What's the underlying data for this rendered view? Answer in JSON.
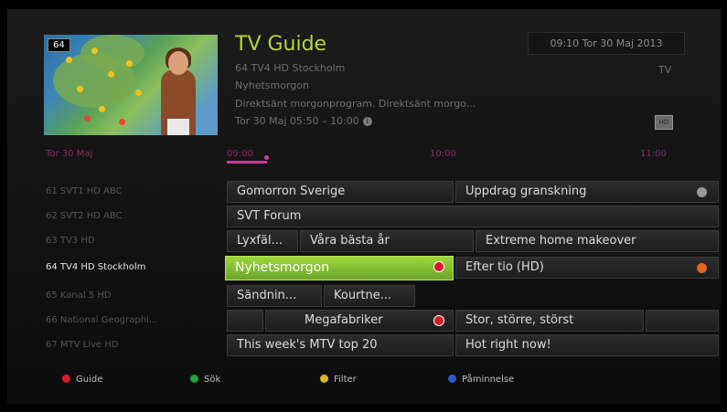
{
  "header": {
    "title": "TV Guide",
    "clock": "09:10  Tor 30 Maj 2013",
    "tv_tag": "TV",
    "preview_channel": "64",
    "program_channel": "64 TV4 HD Stockholm",
    "program_title": "Nyhetsmorgon",
    "program_desc": "Direktsänt morgonprogram. Direktsänt morgo...",
    "program_time": "Tor 30 Maj 05:50 – 10:00",
    "info_icon": "i",
    "hd_icon": "HD"
  },
  "timeline": {
    "date": "Tor 30 Maj",
    "times": [
      "09:00",
      "10:00",
      "11:00"
    ],
    "progress": 0.15
  },
  "rows": [
    {
      "channel": "61  SVT1 HD ABC",
      "selected": false,
      "programs": [
        {
          "title": "Gomorron Sverige",
          "status": ""
        },
        {
          "title": "Uppdrag granskning",
          "status": "reminder"
        }
      ]
    },
    {
      "channel": "62  SVT2 HD ABC",
      "selected": false,
      "programs": [
        {
          "title": "SVT Forum",
          "status": ""
        }
      ]
    },
    {
      "channel": "63  TV3 HD",
      "selected": false,
      "programs": [
        {
          "title": "Lyxfäl...",
          "status": ""
        },
        {
          "title": "Våra bästa år",
          "status": ""
        },
        {
          "title": "Extreme home makeover",
          "status": ""
        }
      ]
    },
    {
      "channel": "64  TV4 HD Stockholm",
      "selected": true,
      "programs": [
        {
          "title": "Nyhetsmorgon",
          "status": "record"
        },
        {
          "title": "Efter tio (HD)",
          "status": "reminder-orange"
        }
      ]
    },
    {
      "channel": "65  Kanal 5 HD",
      "selected": false,
      "programs": [
        {
          "title": "Sändnin...",
          "status": ""
        },
        {
          "title": "Kourtne...",
          "status": ""
        }
      ]
    },
    {
      "channel": "66  National Geographi...",
      "selected": false,
      "programs": [
        {
          "title": "",
          "status": ""
        },
        {
          "title": "Megafabriker",
          "status": "record"
        },
        {
          "title": "Stor, större, störst",
          "status": ""
        },
        {
          "title": "",
          "status": ""
        }
      ]
    },
    {
      "channel": "67  MTV Live HD",
      "selected": false,
      "programs": [
        {
          "title": "This week's MTV top 20",
          "status": ""
        },
        {
          "title": "Hot right now!",
          "status": ""
        }
      ]
    }
  ],
  "footer": {
    "guide": "Guide",
    "guide_color": "#d81e2a",
    "search": "Sök",
    "search_color": "#1ea83a",
    "filter": "Filter",
    "filter_color": "#e0b820",
    "reminder": "Påminnelse",
    "reminder_color": "#2a5ad0"
  },
  "colors": {
    "accent": "#b6d63a",
    "active_cell": "#8cc63a",
    "timeline": "#c43a9a"
  }
}
